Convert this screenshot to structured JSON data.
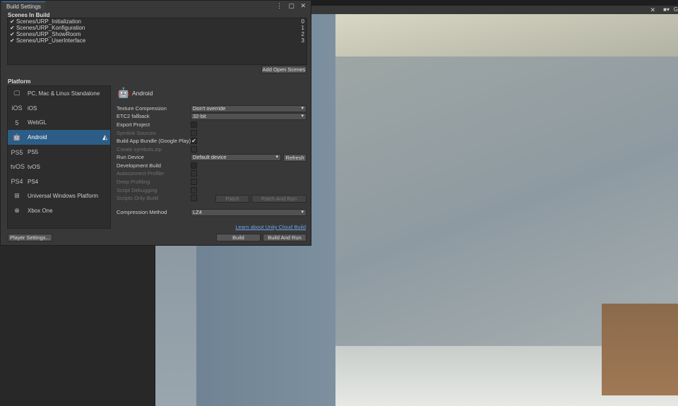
{
  "window": {
    "title": "Build Settings",
    "controls": "⋮ ▢ ✕"
  },
  "scenes": {
    "header": "Scenes In Build",
    "items": [
      {
        "name": "Scenes/URP_Initialization",
        "index": "0"
      },
      {
        "name": "Scenes/URP_Konfiguration",
        "index": "1"
      },
      {
        "name": "Scenes/URP_ShowRoom",
        "index": "2"
      },
      {
        "name": "Scenes/URP_UserInterface",
        "index": "3"
      }
    ],
    "add_open_scenes": "Add Open Scenes"
  },
  "platform": {
    "header": "Platform",
    "items": [
      {
        "label": "PC, Mac & Linux Standalone",
        "icon": "🖵"
      },
      {
        "label": "iOS",
        "icon": "iOS"
      },
      {
        "label": "WebGL",
        "icon": "5"
      },
      {
        "label": "Android",
        "icon": "🤖"
      },
      {
        "label": "PS5",
        "icon": "PS5"
      },
      {
        "label": "tvOS",
        "icon": "tvOS"
      },
      {
        "label": "PS4",
        "icon": "PS4"
      },
      {
        "label": "Universal Windows Platform",
        "icon": "⊞"
      },
      {
        "label": "Xbox One",
        "icon": "⊗"
      }
    ],
    "selected": "Android"
  },
  "settings": {
    "title": "Android",
    "texture_compression": {
      "label": "Texture Compression",
      "value": "Don't override"
    },
    "etc2_fallback": {
      "label": "ETC2 fallback",
      "value": "32-bit"
    },
    "export_project": "Export Project",
    "symlink_sources": "Symlink Sources",
    "build_app_bundle": "Build App Bundle (Google Play)",
    "create_symbols": "Create symbols.zip",
    "run_device": {
      "label": "Run Device",
      "value": "Default device",
      "refresh": "Refresh"
    },
    "development_build": "Development Build",
    "autoconnect_profiler": "Autoconnect Profiler",
    "deep_profiling": "Deep Profiling",
    "script_debugging": "Script Debugging",
    "scripts_only_build": "Scripts Only Build",
    "patch": "Patch",
    "patch_and_run": "Patch And Run",
    "compression": {
      "label": "Compression Method",
      "value": "LZ4"
    },
    "cloud_link": "Learn about Unity Cloud Build",
    "build": "Build",
    "build_and_run": "Build And Run"
  },
  "player_settings": "Player Settings...",
  "check": "✔"
}
